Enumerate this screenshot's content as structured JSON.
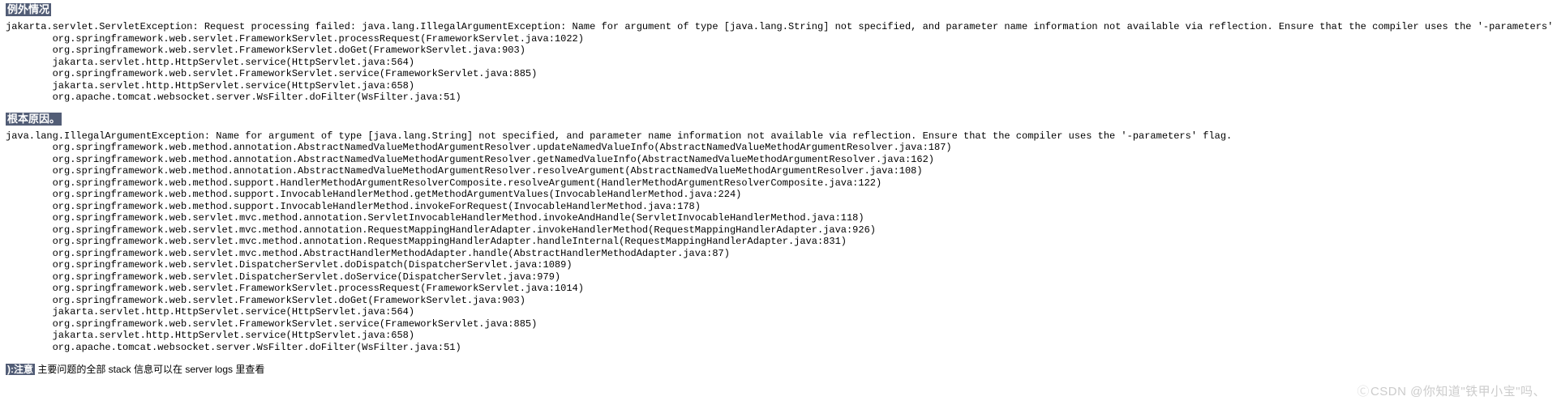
{
  "sections": {
    "exception": {
      "heading": "例外情况",
      "message": "jakarta.servlet.ServletException: Request processing failed: java.lang.IllegalArgumentException: Name for argument of type [java.lang.String] not specified, and parameter name information not available via reflection. Ensure that the compiler uses the '-parameters' flag.",
      "stack": [
        "org.springframework.web.servlet.FrameworkServlet.processRequest(FrameworkServlet.java:1022)",
        "org.springframework.web.servlet.FrameworkServlet.doGet(FrameworkServlet.java:903)",
        "jakarta.servlet.http.HttpServlet.service(HttpServlet.java:564)",
        "org.springframework.web.servlet.FrameworkServlet.service(FrameworkServlet.java:885)",
        "jakarta.servlet.http.HttpServlet.service(HttpServlet.java:658)",
        "org.apache.tomcat.websocket.server.WsFilter.doFilter(WsFilter.java:51)"
      ]
    },
    "root_cause": {
      "heading": "根本原因。",
      "message": "java.lang.IllegalArgumentException: Name for argument of type [java.lang.String] not specified, and parameter name information not available via reflection. Ensure that the compiler uses the '-parameters' flag.",
      "stack": [
        "org.springframework.web.method.annotation.AbstractNamedValueMethodArgumentResolver.updateNamedValueInfo(AbstractNamedValueMethodArgumentResolver.java:187)",
        "org.springframework.web.method.annotation.AbstractNamedValueMethodArgumentResolver.getNamedValueInfo(AbstractNamedValueMethodArgumentResolver.java:162)",
        "org.springframework.web.method.annotation.AbstractNamedValueMethodArgumentResolver.resolveArgument(AbstractNamedValueMethodArgumentResolver.java:108)",
        "org.springframework.web.method.support.HandlerMethodArgumentResolverComposite.resolveArgument(HandlerMethodArgumentResolverComposite.java:122)",
        "org.springframework.web.method.support.InvocableHandlerMethod.getMethodArgumentValues(InvocableHandlerMethod.java:224)",
        "org.springframework.web.method.support.InvocableHandlerMethod.invokeForRequest(InvocableHandlerMethod.java:178)",
        "org.springframework.web.servlet.mvc.method.annotation.ServletInvocableHandlerMethod.invokeAndHandle(ServletInvocableHandlerMethod.java:118)",
        "org.springframework.web.servlet.mvc.method.annotation.RequestMappingHandlerAdapter.invokeHandlerMethod(RequestMappingHandlerAdapter.java:926)",
        "org.springframework.web.servlet.mvc.method.annotation.RequestMappingHandlerAdapter.handleInternal(RequestMappingHandlerAdapter.java:831)",
        "org.springframework.web.servlet.mvc.method.AbstractHandlerMethodAdapter.handle(AbstractHandlerMethodAdapter.java:87)",
        "org.springframework.web.servlet.DispatcherServlet.doDispatch(DispatcherServlet.java:1089)",
        "org.springframework.web.servlet.DispatcherServlet.doService(DispatcherServlet.java:979)",
        "org.springframework.web.servlet.FrameworkServlet.processRequest(FrameworkServlet.java:1014)",
        "org.springframework.web.servlet.FrameworkServlet.doGet(FrameworkServlet.java:903)",
        "jakarta.servlet.http.HttpServlet.service(HttpServlet.java:564)",
        "org.springframework.web.servlet.FrameworkServlet.service(FrameworkServlet.java:885)",
        "jakarta.servlet.http.HttpServlet.service(HttpServlet.java:658)",
        "org.apache.tomcat.websocket.server.WsFilter.doFilter(WsFilter.java:51)"
      ]
    }
  },
  "note": {
    "label": "):注意",
    "text": " 主要问题的全部 stack 信息可以在 server logs 里查看"
  },
  "watermark": {
    "text": "CSDN @你知道\"铁甲小宝\"吗、"
  }
}
